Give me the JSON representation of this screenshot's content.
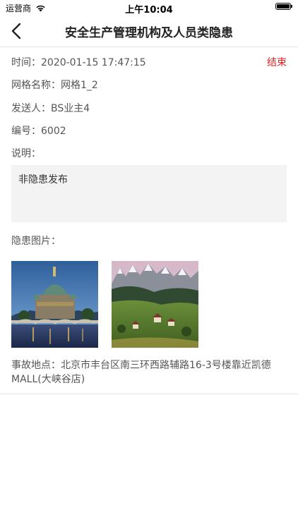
{
  "status_bar": {
    "carrier": "运营商",
    "time": "上午10:04",
    "battery_level": 1.0
  },
  "nav": {
    "title": "安全生产管理机构及人员类隐患"
  },
  "detail": {
    "time_label": "时间：",
    "time_value": "2020-01-15 17:47:15",
    "status": "结束",
    "grid_label": "网格名称：",
    "grid_value": "网格1_2",
    "sender_label": "发送人：",
    "sender_value": "BS业主4",
    "number_label": "编号：",
    "number_value": "6002",
    "desc_label": "说明：",
    "desc_value": "非隐患发布",
    "images_label": "隐患图片：",
    "address_label": "事故地点：",
    "address_value": "北京市丰台区南三环西路辅路16-3号楼靠近凯德MALL(大峡谷店)"
  },
  "colors": {
    "status_red": "#e02020",
    "divider": "#e5e5e5",
    "desc_bg": "#f3f3f3"
  }
}
